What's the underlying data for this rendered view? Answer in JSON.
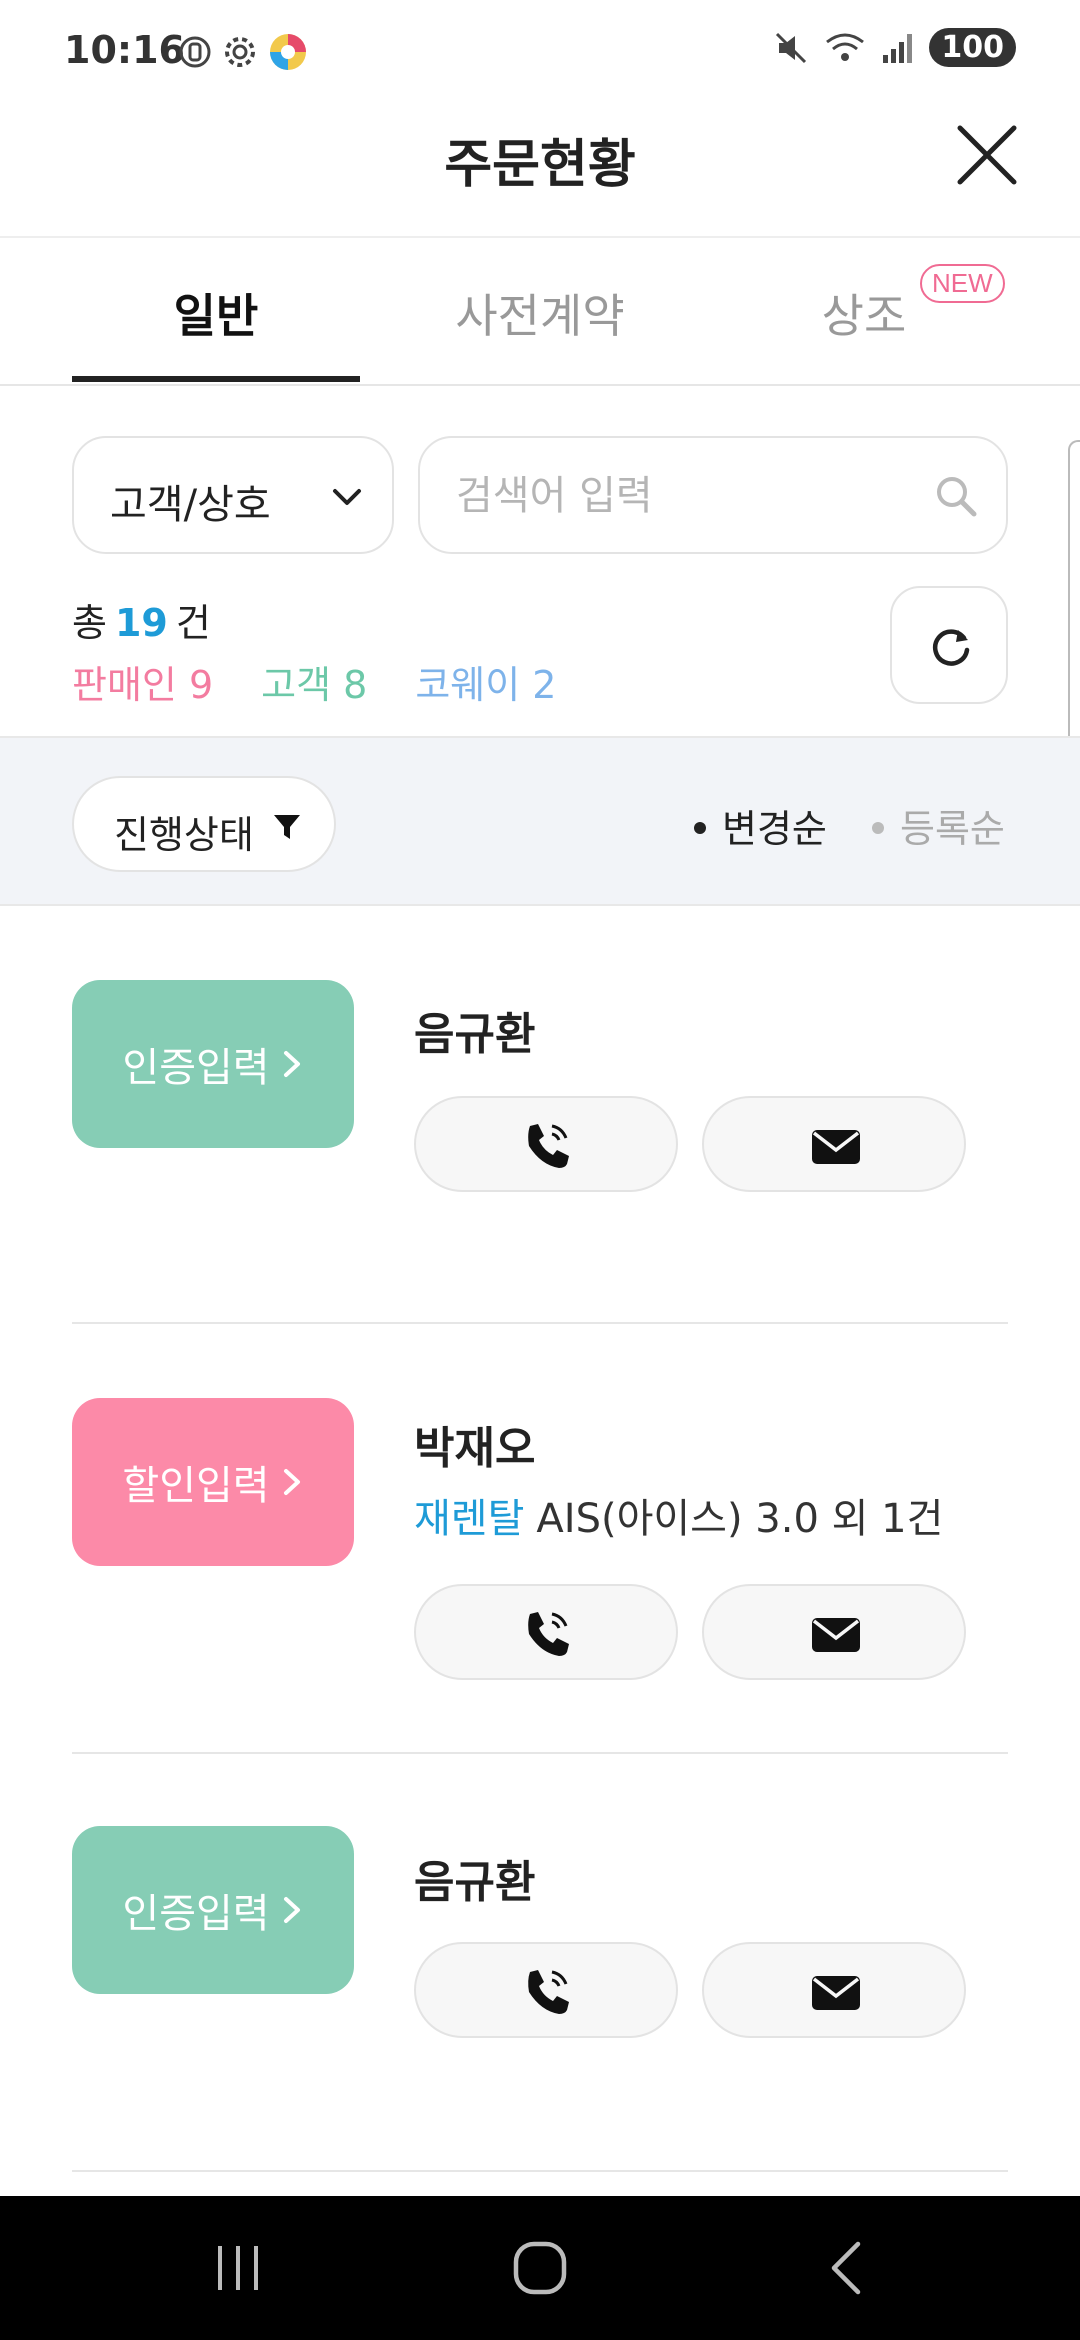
{
  "status_bar": {
    "time": "10:16",
    "battery": "100",
    "left_icons": [
      "do-not-disturb-icon",
      "gear-icon",
      "app-logo-icon"
    ],
    "right_icons": [
      "mute-icon",
      "wifi-icon",
      "signal-icon"
    ]
  },
  "header": {
    "title": "주문현황",
    "close_icon": "close-icon"
  },
  "tabs": [
    {
      "label": "일반",
      "active": true
    },
    {
      "label": "사전계약",
      "active": false
    },
    {
      "label": "상조",
      "active": false,
      "badge": "NEW"
    }
  ],
  "search": {
    "select_value": "고객/상호",
    "placeholder": "검색어 입력"
  },
  "summary": {
    "total_prefix": "총",
    "total_count": "19",
    "total_suffix": "건",
    "seller": "판매인 9",
    "customer": "고객 8",
    "coway": "코웨이 2"
  },
  "filter": {
    "status_label": "진행상태",
    "sort_changed": "변경순",
    "sort_registered": "등록순"
  },
  "orders": [
    {
      "action": "인증입력",
      "name": "음규환",
      "product_tag": "",
      "product": "",
      "color": "#86cdb5"
    },
    {
      "action": "할인입력",
      "name": "박재오",
      "product_tag": "재렌탈",
      "product": "AIS(아이스) 3.0 외 1건",
      "color": "#fc8aa8"
    },
    {
      "action": "인증입력",
      "name": "음규환",
      "product_tag": "",
      "product": "",
      "color": "#86cdb5"
    }
  ],
  "colors": {
    "accent_blue": "#1e9bd7",
    "seller_pink": "#f37ca0",
    "customer_green": "#6cc8a8",
    "coway_blue": "#7eb3ea"
  }
}
